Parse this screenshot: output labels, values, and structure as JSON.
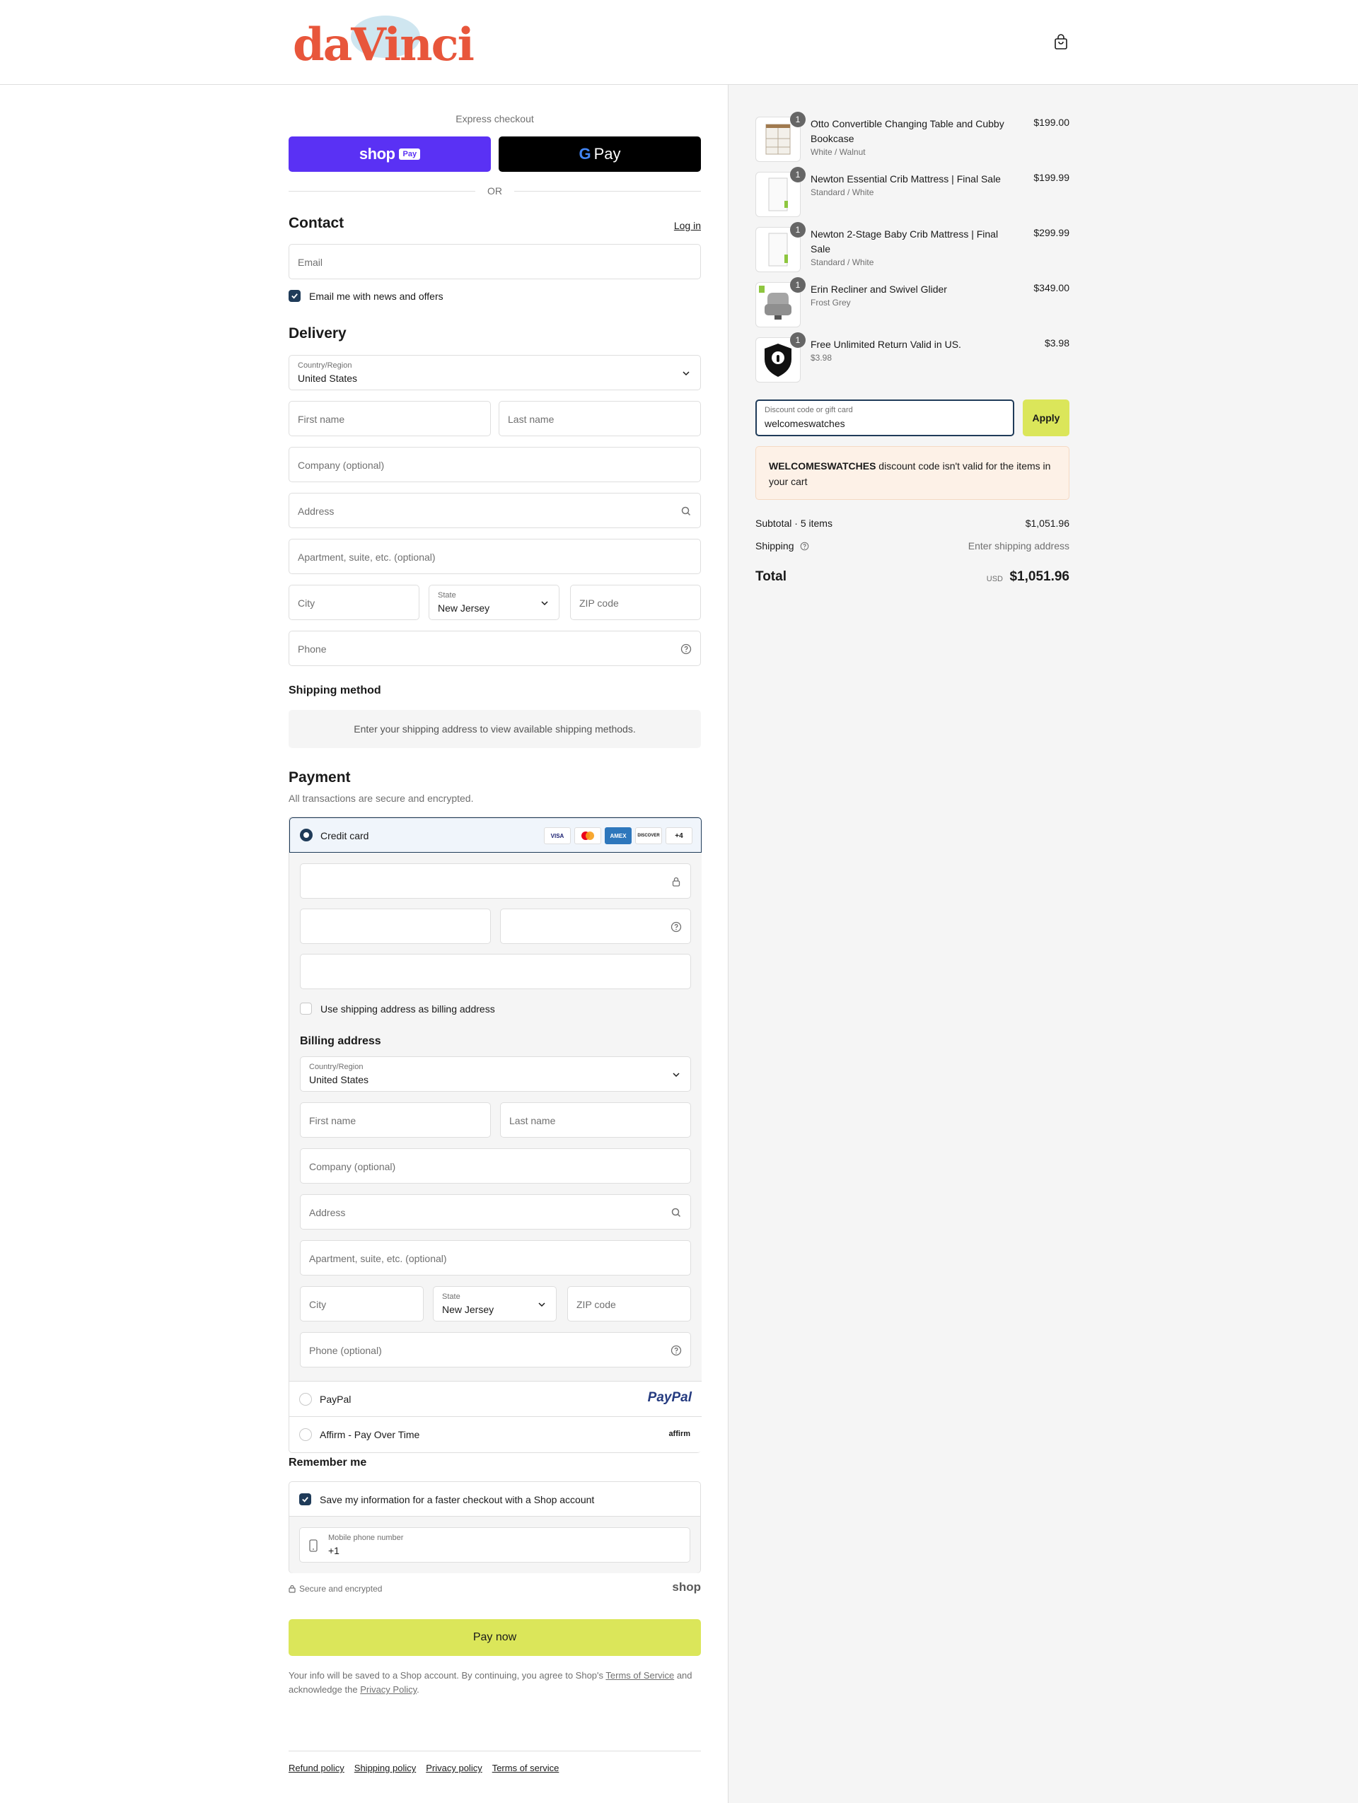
{
  "header": {
    "logo_text": "daVinci",
    "cart_icon": "shopping-bag-icon"
  },
  "express": {
    "title": "Express checkout",
    "shop_pay_label": "shop",
    "shop_pay_badge": "Pay",
    "gpay_g": "G",
    "gpay_label": "Pay",
    "or": "OR"
  },
  "contact": {
    "title": "Contact",
    "login": "Log in",
    "email_placeholder": "Email",
    "news_label": "Email me with news and offers"
  },
  "delivery": {
    "title": "Delivery",
    "country_label": "Country/Region",
    "country_value": "United States",
    "first_name": "First name",
    "last_name": "Last name",
    "company": "Company (optional)",
    "address": "Address",
    "apartment": "Apartment, suite, etc. (optional)",
    "city": "City",
    "state_label": "State",
    "state_value": "New Jersey",
    "zip": "ZIP code",
    "phone": "Phone"
  },
  "shipping_method": {
    "title": "Shipping method",
    "message": "Enter your shipping address to view available shipping methods."
  },
  "payment": {
    "title": "Payment",
    "subtitle": "All transactions are secure and encrypted.",
    "credit_card_label": "Credit card",
    "card_logos": [
      "VISA",
      "MC",
      "AMEX",
      "DISCOVER"
    ],
    "more_cards": "+4",
    "use_shipping_label": "Use shipping address as billing address",
    "billing_title": "Billing address",
    "billing": {
      "country_label": "Country/Region",
      "country_value": "United States",
      "first_name": "First name",
      "last_name": "Last name",
      "company": "Company (optional)",
      "address": "Address",
      "apartment": "Apartment, suite, etc. (optional)",
      "city": "City",
      "state_label": "State",
      "state_value": "New Jersey",
      "zip": "ZIP code",
      "phone": "Phone (optional)"
    },
    "paypal_label": "PayPal",
    "paypal_logo": "PayPal",
    "affirm_label": "Affirm - Pay Over Time",
    "affirm_logo": "affirm"
  },
  "remember": {
    "title": "Remember me",
    "save_label": "Save my information for a faster checkout with a Shop account",
    "phone_label": "Mobile phone number",
    "phone_value": "+1",
    "secure_text": "Secure and encrypted",
    "shop_logo": "shop"
  },
  "pay_now": "Pay now",
  "legal": {
    "before": "Your info will be saved to a Shop account. By continuing, you agree to Shop's ",
    "terms": "Terms of Service",
    "middle": " and acknowledge the ",
    "privacy": "Privacy Policy",
    "end": "."
  },
  "footer": [
    "Refund policy",
    "Shipping policy",
    "Privacy policy",
    "Terms of service"
  ],
  "summary": {
    "items": [
      {
        "name": "Otto Convertible Changing Table and Cubby Bookcase",
        "variant": "White / Walnut",
        "price": "$199.00",
        "qty": "1"
      },
      {
        "name": "Newton Essential Crib Mattress | Final Sale",
        "variant": "Standard / White",
        "price": "$199.99",
        "qty": "1"
      },
      {
        "name": "Newton 2-Stage Baby Crib Mattress | Final Sale",
        "variant": "Standard / White",
        "price": "$299.99",
        "qty": "1"
      },
      {
        "name": "Erin Recliner and Swivel Glider",
        "variant": "Frost Grey",
        "price": "$349.00",
        "qty": "1"
      },
      {
        "name": "Free Unlimited Return Valid in US.",
        "variant": "$3.98",
        "price": "$3.98",
        "qty": "1"
      }
    ],
    "discount_label": "Discount code or gift card",
    "discount_value": "welcomeswatches",
    "apply": "Apply",
    "error_code": "WELCOMESWATCHES",
    "error_text": " discount code isn't valid for the items in your cart",
    "subtotal_label": "Subtotal · 5 items",
    "subtotal_value": "$1,051.96",
    "shipping_label": "Shipping",
    "shipping_value": "Enter shipping address",
    "total_label": "Total",
    "currency": "USD",
    "total_value": "$1,051.96"
  }
}
